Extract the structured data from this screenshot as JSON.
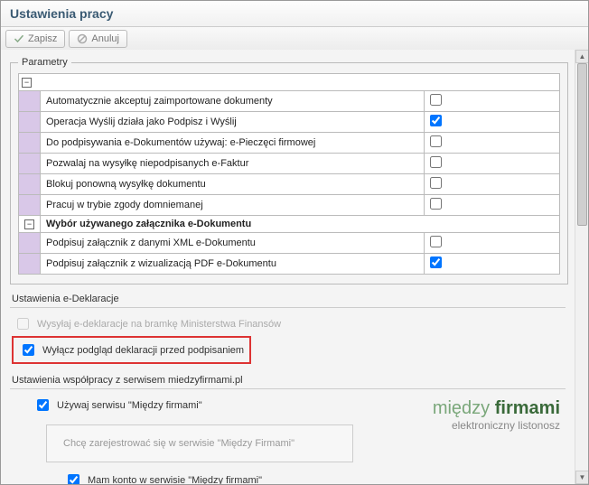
{
  "window": {
    "title": "Ustawienia pracy"
  },
  "toolbar": {
    "save_label": "Zapisz",
    "cancel_label": "Anuluj"
  },
  "params": {
    "legend": "Parametry",
    "rows": [
      {
        "label": "Automatycznie akceptuj zaimportowane dokumenty",
        "checked": false
      },
      {
        "label": "Operacja Wyślij działa jako Podpisz i Wyślij",
        "checked": true
      },
      {
        "label": "Do podpisywania e-Dokumentów używaj: e-Pieczęci firmowej",
        "checked": false
      },
      {
        "label": "Pozwalaj na wysyłkę niepodpisanych e-Faktur",
        "checked": false
      },
      {
        "label": "Blokuj ponowną wysyłkę dokumentu",
        "checked": false
      },
      {
        "label": "Pracuj w trybie zgody domniemanej",
        "checked": false
      }
    ],
    "group_header": "Wybór używanego załącznika e-Dokumentu",
    "group_rows": [
      {
        "label": "Podpisuj załącznik z danymi XML e-Dokumentu",
        "checked": false
      },
      {
        "label": "Podpisuj załącznik z wizualizacją PDF e-Dokumentu",
        "checked": true
      }
    ]
  },
  "edecl": {
    "section_label": "Ustawienia e-Deklaracje",
    "send_gateway": {
      "label": "Wysyłaj e-deklaracje na bramkę Ministerstwa Finansów",
      "checked": false
    },
    "disable_preview": {
      "label": "Wyłącz podgląd deklaracji przed podpisaniem",
      "checked": true
    }
  },
  "mf": {
    "section_label": "Ustawienia współpracy z serwisem miedzyfirmami.pl",
    "use_service": {
      "label": "Używaj serwisu \"Między firmami\"",
      "checked": true
    },
    "register_text": "Chcę zarejestrować się w serwisie \"Między Firmami\"",
    "have_account": {
      "label": "Mam konto w serwisie \"Między firmami\"",
      "checked": true
    },
    "logo_main_1": "między",
    "logo_main_2": "firmami",
    "logo_sub": "elektroniczny listonosz"
  }
}
